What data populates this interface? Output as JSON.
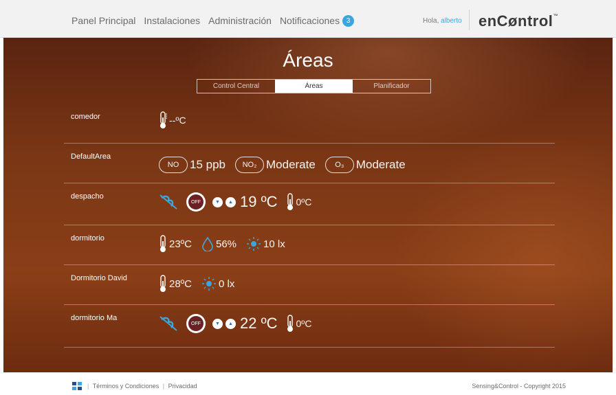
{
  "nav": {
    "items": [
      "Panel Principal",
      "Instalaciones",
      "Administración",
      "Notificaciones"
    ],
    "notifications_count": "3",
    "greeting": "Hola,",
    "user": "alberto",
    "brand": "enCøntrol",
    "brand_tm": "™"
  },
  "page": {
    "title": "Áreas",
    "tabs": [
      "Control Central",
      "Áreas",
      "Planificador"
    ],
    "active_tab": "Áreas"
  },
  "areas": [
    {
      "name": "comedor",
      "temp": "--ºC"
    },
    {
      "name": "DefaultArea",
      "no": "NO",
      "no_value": "15 ppb",
      "no2": "NO₂",
      "no2_value": "Moderate",
      "o3": "O₃",
      "o3_value": "Moderate"
    },
    {
      "name": "despacho",
      "off": "OFF",
      "setpoint": "19 ºC",
      "temp": "0ºC"
    },
    {
      "name": "dormitorio",
      "temp": "23ºC",
      "humidity": "56%",
      "light": "10 lx"
    },
    {
      "name": "Dormitorio David",
      "temp": "28ºC",
      "light": "0 lx"
    },
    {
      "name": "dormitorio Ma",
      "off": "OFF",
      "setpoint": "22 ºC",
      "temp": "0ºC"
    }
  ],
  "footer": {
    "terms": "Términos y Condiciones",
    "privacy": "Privacidad",
    "copyright": "Sensing&Control - Copyright 2015"
  },
  "colors": {
    "accent": "#3aa6e0",
    "off_button": "#6b2024",
    "arrow": "#2a6dbf"
  },
  "icons": [
    "thermometer-icon",
    "droplet-icon",
    "sun-icon",
    "fan-off-icon",
    "arrow-down-icon",
    "arrow-up-icon",
    "no-cloud-icon",
    "no2-cloud-icon",
    "o3-cloud-icon"
  ]
}
